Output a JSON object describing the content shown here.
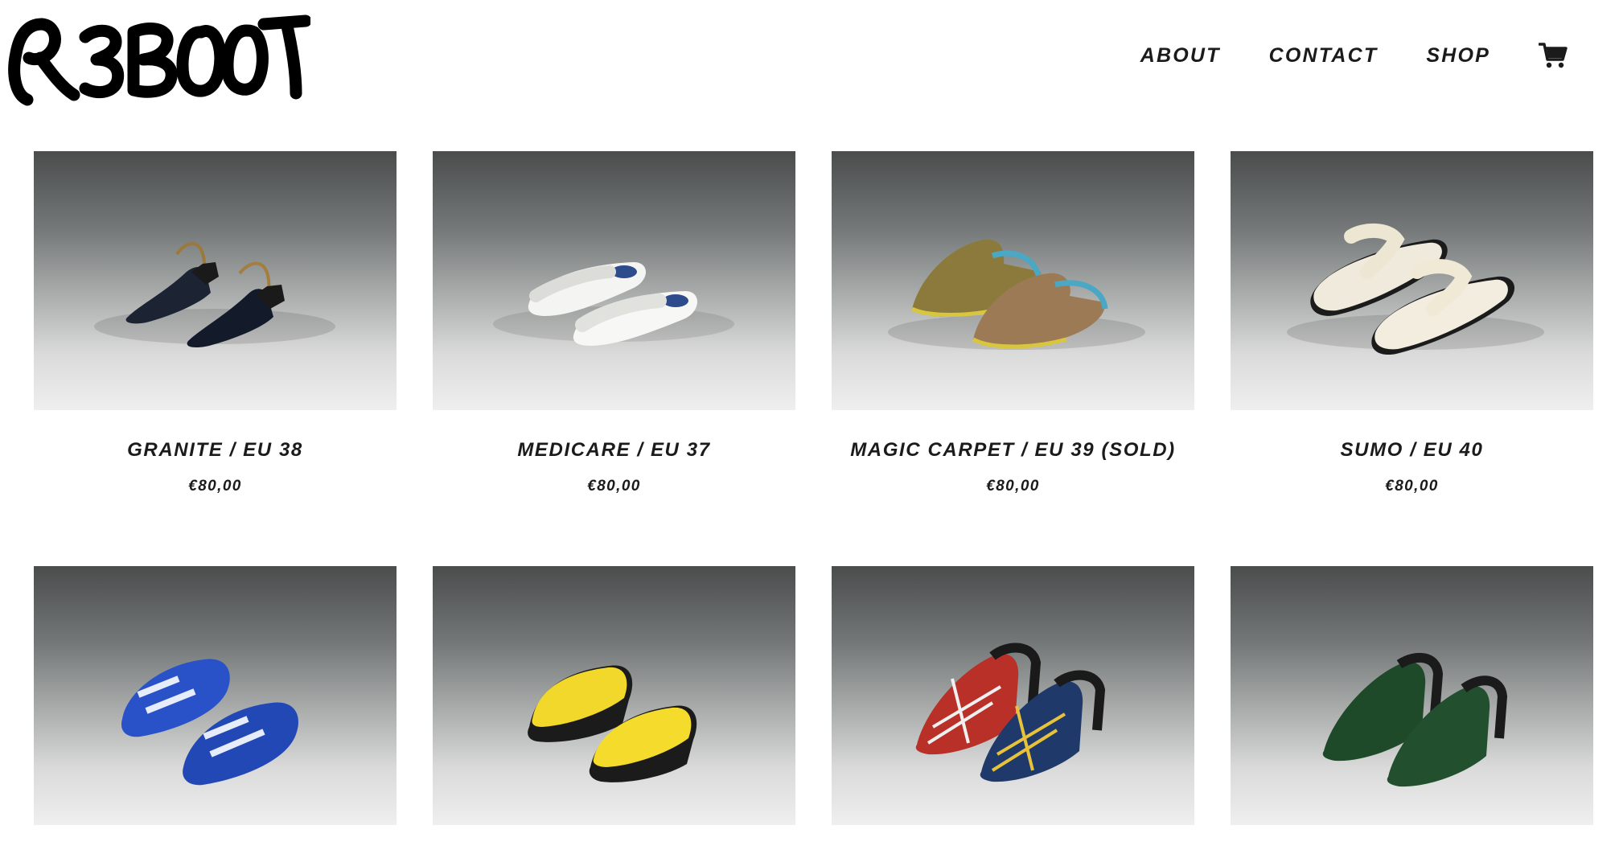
{
  "brand": {
    "logo_text": "R3BOOT"
  },
  "nav": {
    "items": [
      {
        "label": "ABOUT"
      },
      {
        "label": "CONTACT"
      },
      {
        "label": "SHOP"
      }
    ],
    "cart_icon": "shopping-cart-icon"
  },
  "products": [
    {
      "name": "GRANITE / EU 38",
      "price": "€80,00"
    },
    {
      "name": "MEDICARE / EU 37",
      "price": "€80,00"
    },
    {
      "name": "MAGIC CARPET / EU 39 (SOLD)",
      "price": "€80,00"
    },
    {
      "name": "SUMO / EU 40",
      "price": "€80,00"
    },
    {
      "name": "",
      "price": ""
    },
    {
      "name": "",
      "price": ""
    },
    {
      "name": "",
      "price": ""
    },
    {
      "name": "",
      "price": ""
    }
  ],
  "colors": {
    "text": "#1b1b1b",
    "background": "#ffffff",
    "backdrop_top": "#4b4d4d",
    "backdrop_bottom": "#eeefee"
  }
}
